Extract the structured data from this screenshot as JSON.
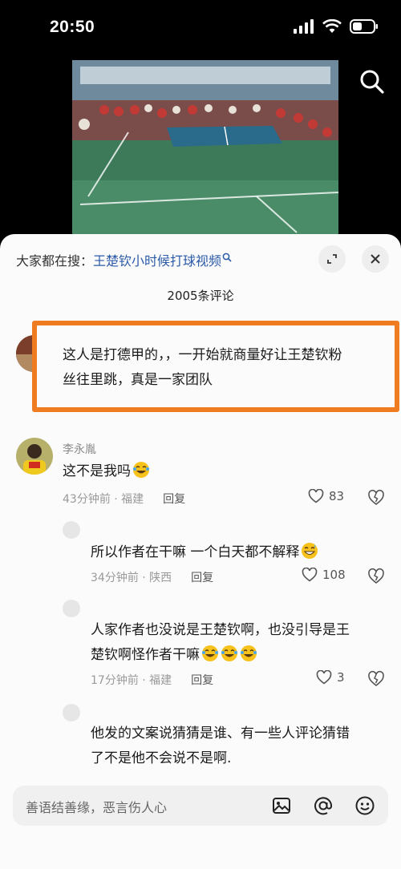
{
  "status": {
    "time": "20:50"
  },
  "sheet": {
    "search_prefix": "大家都在搜：",
    "search_keyword": "王楚钦小时候打球视频",
    "comment_count": "2005条评论"
  },
  "comments": [
    {
      "text_line1": "这人是打德甲的，，一开始就商量好让王楚钦粉",
      "text_line2": "丝往里跳，真是一家团队"
    },
    {
      "username": "李永胤",
      "text": "这不是我吗",
      "time": "43分钟前 · 福建",
      "reply": "回复",
      "likes": "83"
    }
  ],
  "replies": [
    {
      "text": "所以作者在干嘛 一个白天都不解释",
      "time": "34分钟前 · 陕西",
      "reply": "回复",
      "likes": "108"
    },
    {
      "text_line1": "人家作者也没说是王楚钦啊，也没引导是王",
      "text_line2": "楚钦啊怪作者干嘛",
      "time": "17分钟前 · 福建",
      "reply": "回复",
      "likes": "3"
    },
    {
      "text_line1": "他发的文案说猜猜是谁、有一些人评论猜错",
      "text_line2": "了不是他不会说不是啊."
    }
  ],
  "input": {
    "placeholder": "善语结善缘，恶言伤人心"
  },
  "icons": {
    "status": [
      "cellular-signal-icon",
      "wifi-icon",
      "battery-icon"
    ],
    "search": "search-icon",
    "sheet": [
      "minimize-icon",
      "close-icon"
    ],
    "input": [
      "image-icon",
      "at-icon",
      "emoji-icon"
    ]
  },
  "colors": {
    "highlight": "#f07c22",
    "keyword": "#2b5aa8"
  }
}
